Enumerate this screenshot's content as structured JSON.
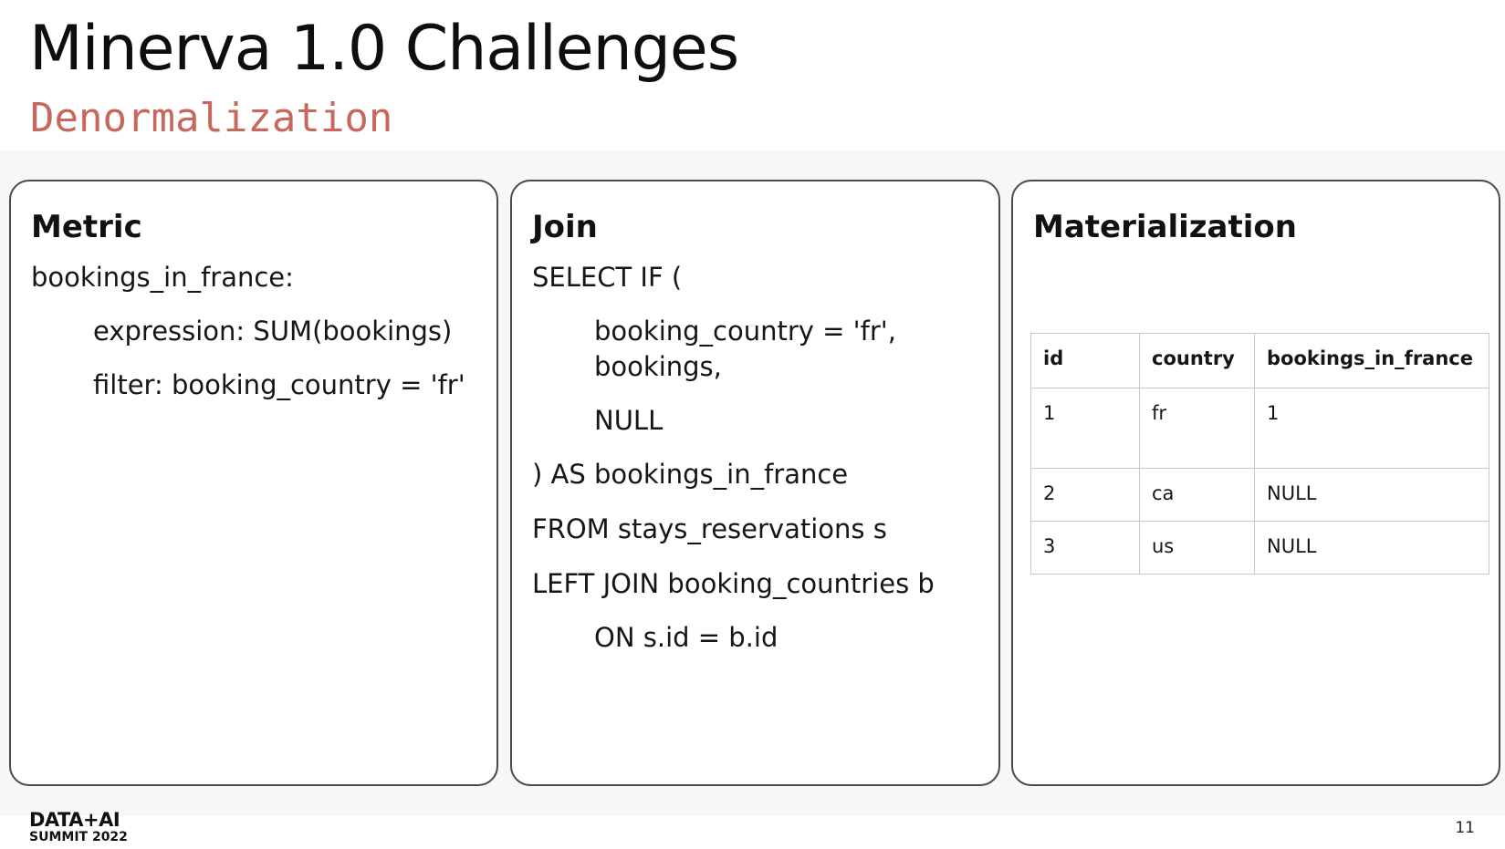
{
  "slide": {
    "title": "Minerva 1.0 Challenges",
    "subtitle": "Denormalization",
    "page_number": "11"
  },
  "panels": {
    "metric": {
      "title": "Metric",
      "lines": [
        "bookings_in_france:",
        "expression: SUM(bookings)",
        "filter: booking_country = 'fr'"
      ]
    },
    "join": {
      "title": "Join",
      "lines": [
        "SELECT IF (",
        "booking_country = 'fr',",
        "bookings,",
        "NULL",
        ") AS bookings_in_france",
        "FROM stays_reservations s",
        "LEFT JOIN booking_countries b",
        "ON s.id = b.id"
      ]
    },
    "materialization": {
      "title": "Materialization",
      "table": {
        "headers": [
          "id",
          "country",
          "bookings_in_france"
        ],
        "rows": [
          [
            "1",
            "fr",
            "1"
          ],
          [
            "2",
            "ca",
            "NULL"
          ],
          [
            "3",
            "us",
            "NULL"
          ]
        ]
      }
    }
  },
  "footer": {
    "logo_top": "DATA+AI",
    "logo_bottom": "SUMMIT 2022"
  },
  "colors": {
    "subtitle": "#c7685e",
    "panel_border": "#4a4a4a",
    "table_border": "#c8c8c8"
  }
}
